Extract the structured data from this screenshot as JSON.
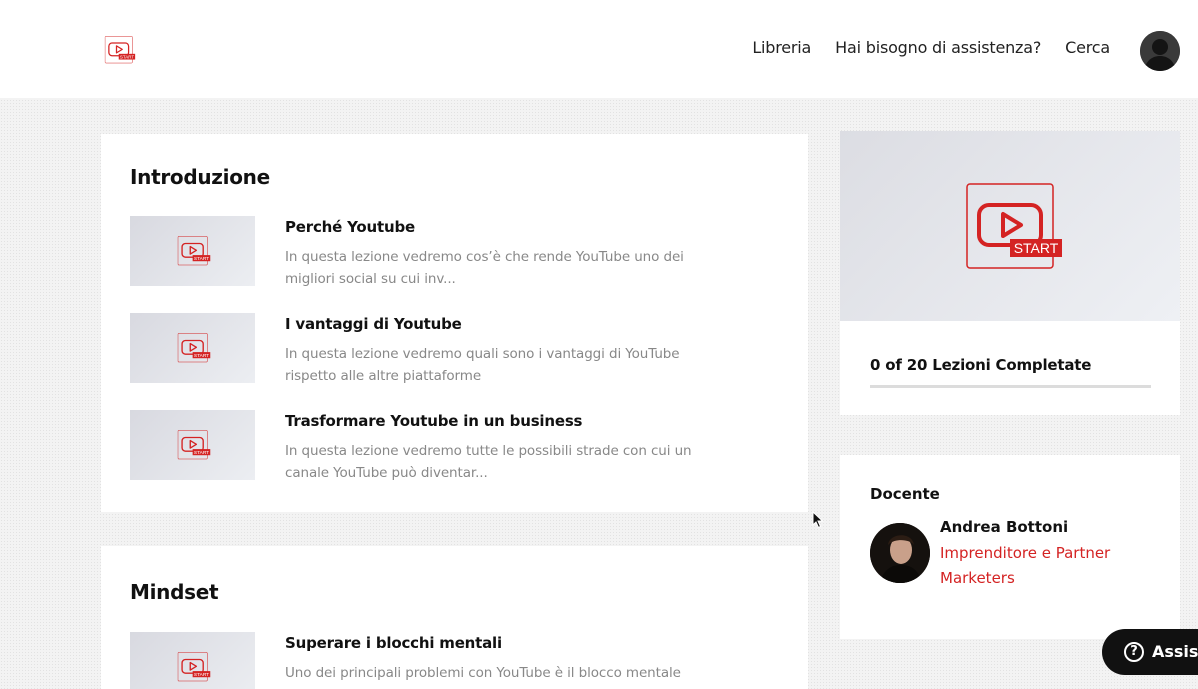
{
  "header": {
    "nav": [
      "Libreria",
      "Hai bisogno di assistenza?",
      "Cerca"
    ]
  },
  "logo_badge_text": "START",
  "sections": [
    {
      "title": "Introduzione",
      "lessons": [
        {
          "title": "Perché Youtube",
          "desc": "In questa lezione vedremo cos’è che rende YouTube uno dei migliori social su cui inv..."
        },
        {
          "title": "I vantaggi di Youtube",
          "desc": "In questa lezione vedremo quali sono i vantaggi di YouTube rispetto alle altre piattaforme"
        },
        {
          "title": "Trasformare Youtube in un business",
          "desc": "In questa lezione vedremo tutte le possibili strade con cui un canale YouTube può diventar..."
        }
      ]
    },
    {
      "title": "Mindset",
      "lessons": [
        {
          "title": "Superare i blocchi mentali",
          "desc": "Uno dei principali problemi con YouTube è il blocco mentale"
        }
      ]
    }
  ],
  "progress": {
    "label": "0 of 20 Lezioni Completate",
    "completed_fraction": 0
  },
  "teacher": {
    "heading": "Docente",
    "name": "Andrea Bottoni",
    "role": "Imprenditore e Partner Marketers"
  },
  "help_button": {
    "label": "Assistenza",
    "icon": "question-icon"
  },
  "colors": {
    "accent": "#d42323",
    "help_bg": "#111111"
  }
}
